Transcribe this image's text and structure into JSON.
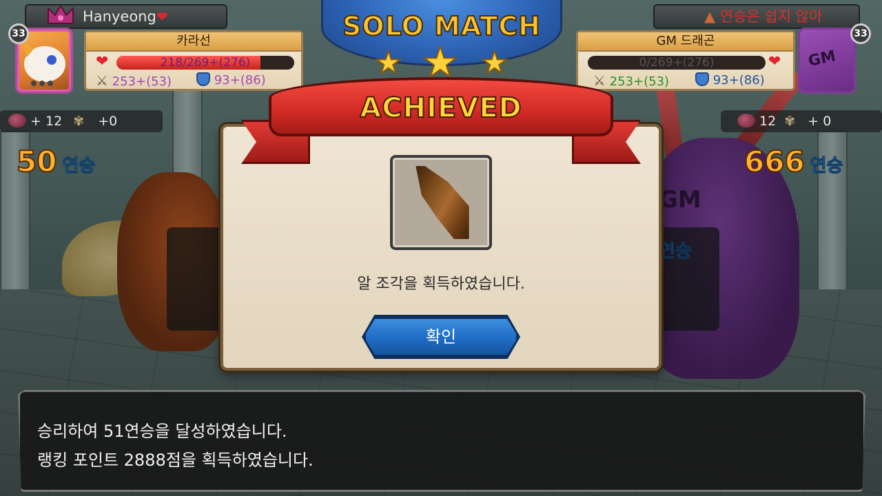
{
  "header": {
    "mode_title": "SOLO MATCH"
  },
  "player_left": {
    "username": "Hanyeong",
    "level": "33",
    "dragon_name": "카라선",
    "hp_text": "218/269+(276)",
    "hp_fraction": 0.81,
    "attack": "253+(53)",
    "defense": "93+(86)",
    "egg_pieces": "+ 12",
    "feathers": "+0",
    "streak_count": "50",
    "streak_label": "연승"
  },
  "player_right": {
    "status_text": "연승은 쉽지 않아",
    "level": "33",
    "portrait_text": "GM",
    "dragon_name": "GM 드래곤",
    "hp_text": "0/269+(276)",
    "hp_fraction": 0.0,
    "attack": "253+(53)",
    "defense": "93+(86)",
    "egg_pieces": "12",
    "feathers": "+ 0",
    "streak_count": "666",
    "streak_label": "연승",
    "mid_streak_label": "연승",
    "body_text": "GM"
  },
  "dialog": {
    "banner_title": "ACHIEVED",
    "item_icon": "egg-shard-icon",
    "message": "알 조각을 획득하였습니다.",
    "confirm_label": "확인"
  },
  "result_box": {
    "line1": "승리하여 51연승을 달성하였습니다.",
    "line2": "랭킹 포인트 2888점을 획득하였습니다."
  },
  "colors": {
    "banner_red": "#d12a24",
    "banner_text": "#ffd73a",
    "button_blue": "#1f6cc4",
    "streak_orange": "#ffb22c",
    "streak_blue": "#5fb9ff"
  }
}
